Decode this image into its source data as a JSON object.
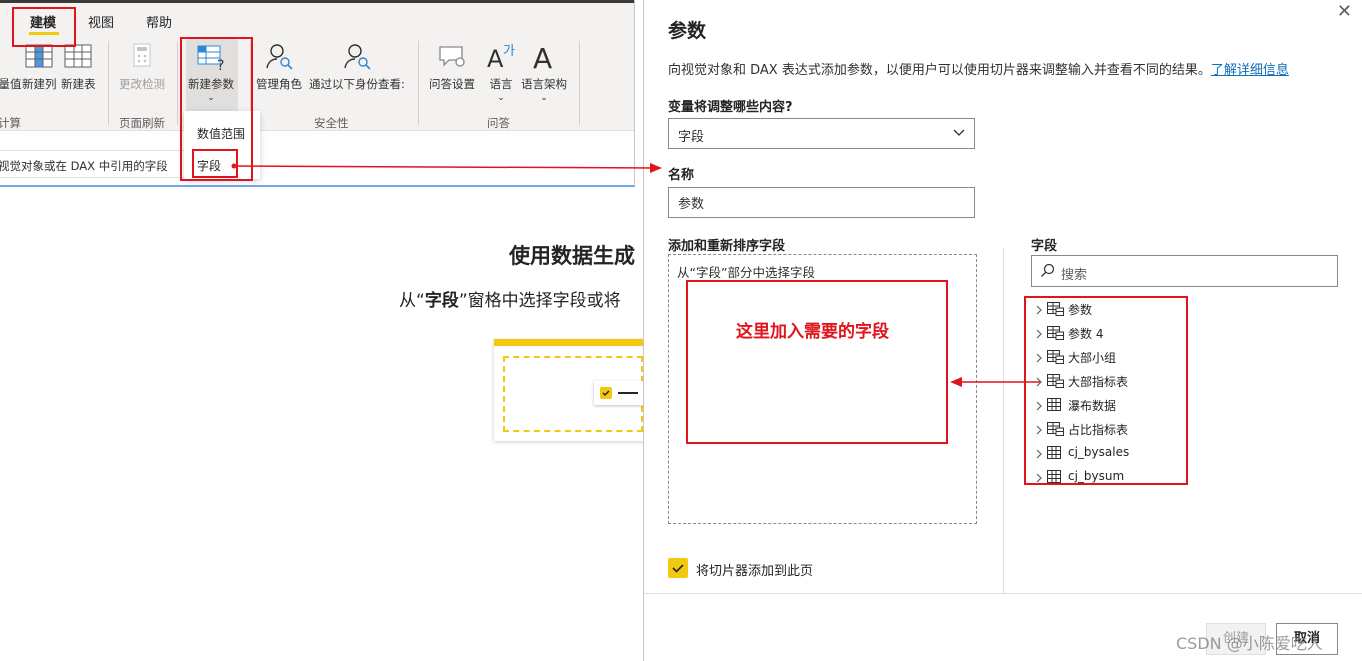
{
  "ribbon": {
    "tabs": [
      "建模",
      "视图",
      "帮助"
    ],
    "buttons": {
      "measure_partial": "量值",
      "new_column": "新建列",
      "new_table": "新建表",
      "change_detect": "更改检测",
      "new_param": "新建参数",
      "manage_roles": "管理角色",
      "view_as": "通过以下身份查看:",
      "qa_setup": "问答设置",
      "language": "语言",
      "linguistic_schema": "语言架构"
    },
    "groups": {
      "calc_partial": "计算",
      "page_refresh": "页面刷新",
      "security": "安全性",
      "qa": "问答"
    },
    "dropdown": {
      "numeric_range": "数值范围",
      "fields": "字段"
    }
  },
  "formula_bar": {
    "text": "视觉对象或在 DAX 中引用的字段"
  },
  "canvas": {
    "title": "使用数据生成",
    "subtitle_pre": "从“",
    "subtitle_bold": "字段",
    "subtitle_post": "”窗格中选择字段或将"
  },
  "dialog": {
    "close_icon": "close-icon",
    "title": "参数",
    "description": "向视觉对象和 DAX 表达式添加参数，以便用户可以使用切片器来调整输入并查看不同的结果。",
    "learn_more": "了解详细信息",
    "what_label": "变量将调整哪些内容?",
    "what_value": "字段",
    "name_label": "名称",
    "name_value": "参数",
    "add_label": "添加和重新排序字段",
    "drop_hint": "从“字段”部分中选择字段",
    "fields_label": "字段",
    "search_placeholder": "搜索",
    "checkbox_label": "将切片器添加到此页",
    "checkbox_checked": true,
    "create_button": "创建",
    "cancel_button": "取消"
  },
  "fields_tree": [
    {
      "label": "参数",
      "icon": "param-table-icon"
    },
    {
      "label": "参数 4",
      "icon": "param-table-icon"
    },
    {
      "label": "大部小组",
      "icon": "param-table-icon"
    },
    {
      "label": "大部指标表",
      "icon": "param-table-icon"
    },
    {
      "label": "瀑布数据",
      "icon": "table-icon"
    },
    {
      "label": "占比指标表",
      "icon": "param-table-icon"
    },
    {
      "label": "cj_bysales",
      "icon": "table-icon"
    },
    {
      "label": "cj_bysum",
      "icon": "table-icon"
    }
  ],
  "annotation": {
    "note": "这里加入需要的字段",
    "color": "#e0151b"
  },
  "watermark": "CSDN @小陈爱吃人",
  "colors": {
    "accent": "#f2c811",
    "link": "#0f6cbd"
  }
}
